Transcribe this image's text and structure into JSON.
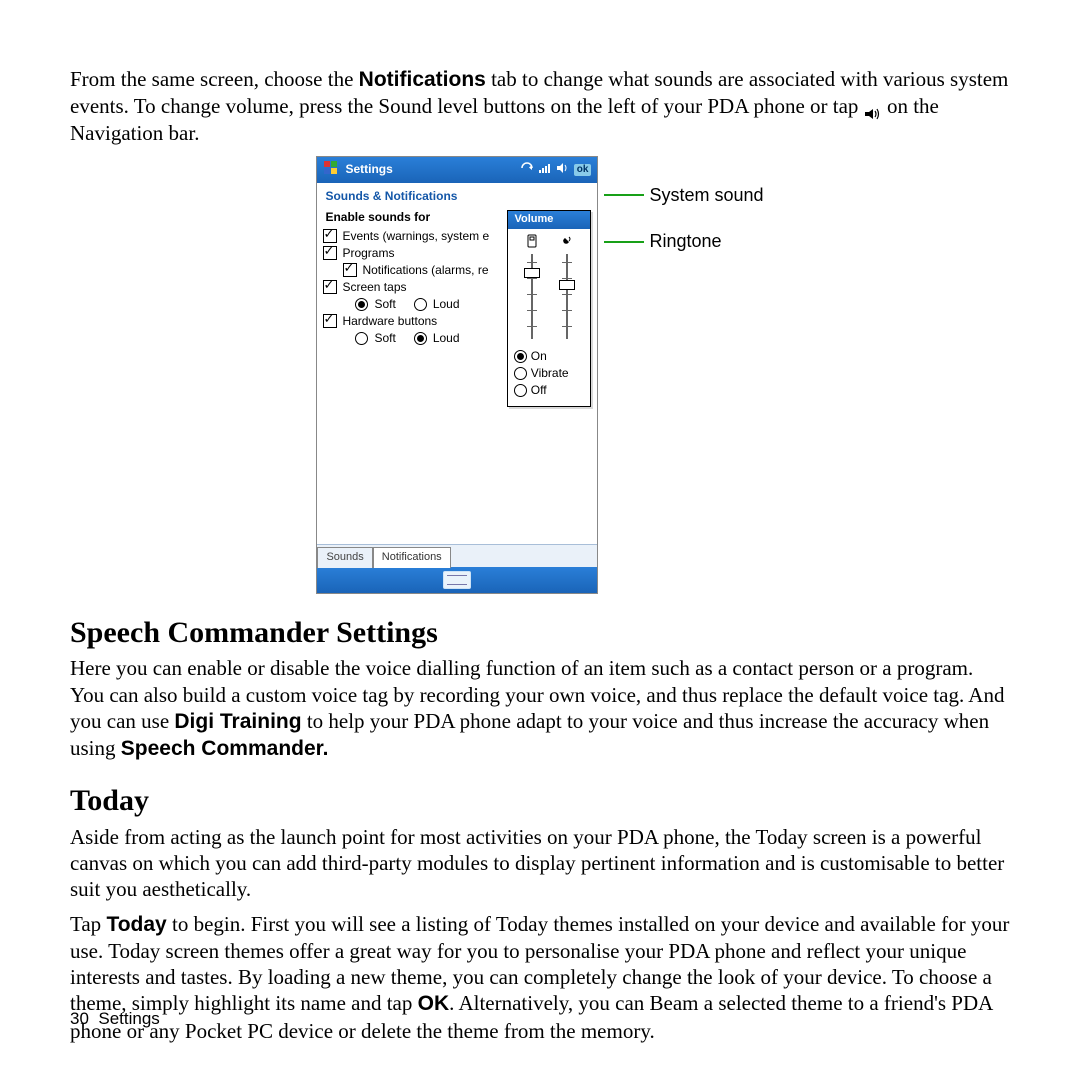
{
  "para_intro_pre": "From the same screen, choose the ",
  "para_intro_bold1": "Notifications",
  "para_intro_mid": " tab to change what sounds are associated with various system events. To change volume, press the Sound level buttons on the left of your PDA phone or tap ",
  "para_intro_post": " on the Navigation bar.",
  "callout_system_sound": "System sound",
  "callout_ringtone": "Ringtone",
  "pda": {
    "titlebar": "Settings",
    "ok": "ok",
    "subtitle": "Sounds & Notifications",
    "enable_title": "Enable sounds for",
    "chk_events": "Events (warnings, system e",
    "chk_programs": "Programs",
    "chk_notifications": "Notifications (alarms, re",
    "chk_screen_taps": "Screen taps",
    "screen_soft": "Soft",
    "screen_loud": "Loud",
    "chk_hardware": "Hardware buttons",
    "hw_soft": "Soft",
    "hw_loud": "Loud",
    "vol_title": "Volume",
    "vol_on": "On",
    "vol_vibrate": "Vibrate",
    "vol_off": "Off",
    "tab_sounds": "Sounds",
    "tab_notifications": "Notifications"
  },
  "h_speech": "Speech Commander Settings",
  "para_speech_pre": "Here you can enable or disable the voice dialling function of an item such as a contact person or a program. You can also build a custom voice tag by recording your own voice, and thus replace the default voice tag. And you can use ",
  "para_speech_b1": "Digi Training",
  "para_speech_mid": " to help your PDA phone adapt to your voice and thus increase the accuracy when using ",
  "para_speech_b2": "Speech Commander.",
  "h_today": "Today",
  "para_today1": "Aside from acting as the launch point for most activities on your PDA phone, the Today screen is a powerful canvas on which you can add third-party modules to display pertinent information and is customisable to better suit you aesthetically.",
  "para_today2_pre": "Tap ",
  "para_today2_b1": "Today",
  "para_today2_mid": " to begin. First you will see a listing of Today themes installed on your device and available for your use. Today screen themes offer a great way for you to personalise your PDA phone and reflect your unique interests and tastes. By loading a new theme, you can completely change the look of your device. To choose a theme, simply highlight its name and tap ",
  "para_today2_b2": "OK",
  "para_today2_post": ". Alternatively, you can Beam a selected theme to a friend's PDA phone or any Pocket PC device or delete the theme from the memory.",
  "footer_page": "30",
  "footer_label": "Settings"
}
